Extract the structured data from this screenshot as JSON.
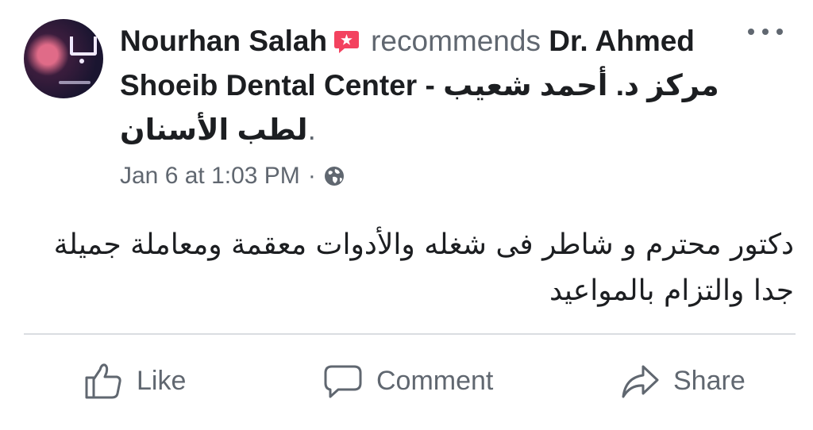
{
  "post": {
    "author": "Nourhan Salah",
    "verb": "recommends",
    "page_name": "Dr. Ahmed Shoeib Dental Center - مركز د. أحمد شعيب لطب الأسنان",
    "page_suffix": ".",
    "timestamp": "Jan 6 at 1:03 PM",
    "meta_separator": "·",
    "privacy_icon": "globe-icon",
    "recommend_icon": "recommend-icon",
    "text": "دكتور محترم  و شاطر فى شغله  والأدوات معقمة ومعاملة جميلة جدا والتزام بالمواعيد"
  },
  "actions": {
    "like": "Like",
    "comment": "Comment",
    "share": "Share"
  },
  "colors": {
    "text_primary": "#1c1e21",
    "text_secondary": "#606770",
    "recommend_red": "#f3425f",
    "divider": "#dadde1"
  }
}
